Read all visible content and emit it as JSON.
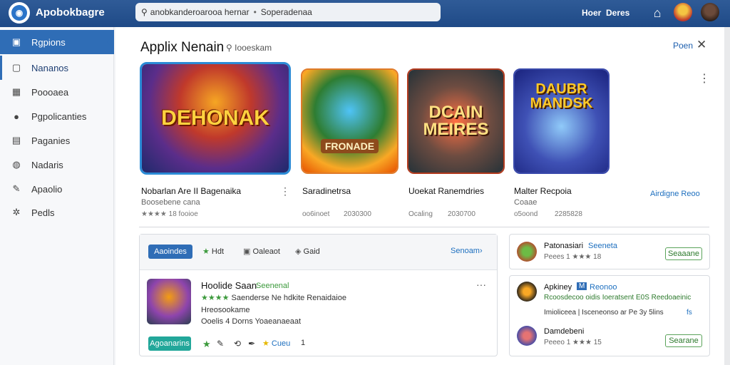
{
  "header": {
    "app_title": "Apobokbagre",
    "search_text": "anobkanderoarooa hernar",
    "search_sep": "•",
    "search_suffix": "Soperadenaa",
    "nav_link_1": "Hoer",
    "nav_link_2": "Deres"
  },
  "sidebar": {
    "items": [
      {
        "label": "Rgpions",
        "icon": "window-icon"
      },
      {
        "label": "Nananos",
        "icon": "square-icon"
      },
      {
        "label": "Poooaea",
        "icon": "grid-icon"
      },
      {
        "label": "Pgpolicanties",
        "icon": "user-icon"
      },
      {
        "label": "Paganies",
        "icon": "list-icon"
      },
      {
        "label": "Nadaris",
        "icon": "chat-icon"
      },
      {
        "label": "Apaolio",
        "icon": "tool-icon"
      },
      {
        "label": "Pedls",
        "icon": "gear-icon"
      }
    ]
  },
  "main": {
    "title": "Applix Nenain",
    "search_label": "Iooeskam",
    "open_link": "Poen",
    "games": [
      {
        "art_title": "DEHONAK",
        "name": "Nobarlan Are II Bagenaika",
        "sub": "Boosebene cana",
        "meta_left": "★★★★ 18 fooioe",
        "meta_right": ""
      },
      {
        "art_title": "FRONADE",
        "name": "Saradinetrsa",
        "sub": "",
        "meta_left": "oo6inoet",
        "meta_right": "2030300"
      },
      {
        "art_title": "DCAIN MEIRES",
        "name": "Uoekat Ranemdries",
        "sub": "",
        "meta_left": "Ocaling",
        "meta_right": "2030700"
      },
      {
        "art_title": "DAUBR MANDSK",
        "name": "Malter Recpoia",
        "sub": "Coaae",
        "meta_left": "o5oond",
        "meta_right": "2285828"
      }
    ],
    "see_more": "Airdigne Reoo"
  },
  "feature_panel": {
    "primary_button": "Aaoindes",
    "tab_1": "Hdt",
    "tab_2": "Oaleaot",
    "tab_3": "Gaid",
    "see_all": "Senoam",
    "item": {
      "title": "Hoolide Saan",
      "tag": "Seenenal",
      "line1": "Saenderse Ne hdkite Renaidaioe",
      "line2": "Hreosookame",
      "line3": "Ooelis 4 Dorns Yoaeanaeaat",
      "action_button": "Agoanarins",
      "footer_link": "Cueu",
      "footer_count": "1"
    }
  },
  "side_panel": {
    "card1": {
      "title": "Patonasiari",
      "link": "Seeneta",
      "meta": "Peees 1 ★★★ 18",
      "button": "Seaaane"
    },
    "card2": {
      "title": "Apkiney",
      "badge": "M",
      "link": "Reonoo",
      "line1": "Rcoosdecoo oidis Ioeratsent E0S Reedoaeinic",
      "line2": "Imioliceea | Isceneonso ar Pe 3y 5lins",
      "line2_end": "fs",
      "item2_title": "Damdebeni",
      "item2_meta": "Peeeo 1 ★★★ 15",
      "button": "Searane"
    }
  },
  "colors": {
    "topbar": "#2a5596",
    "accent_blue": "#2f6db6",
    "green": "#3c9a3c",
    "teal": "#22a79a"
  }
}
